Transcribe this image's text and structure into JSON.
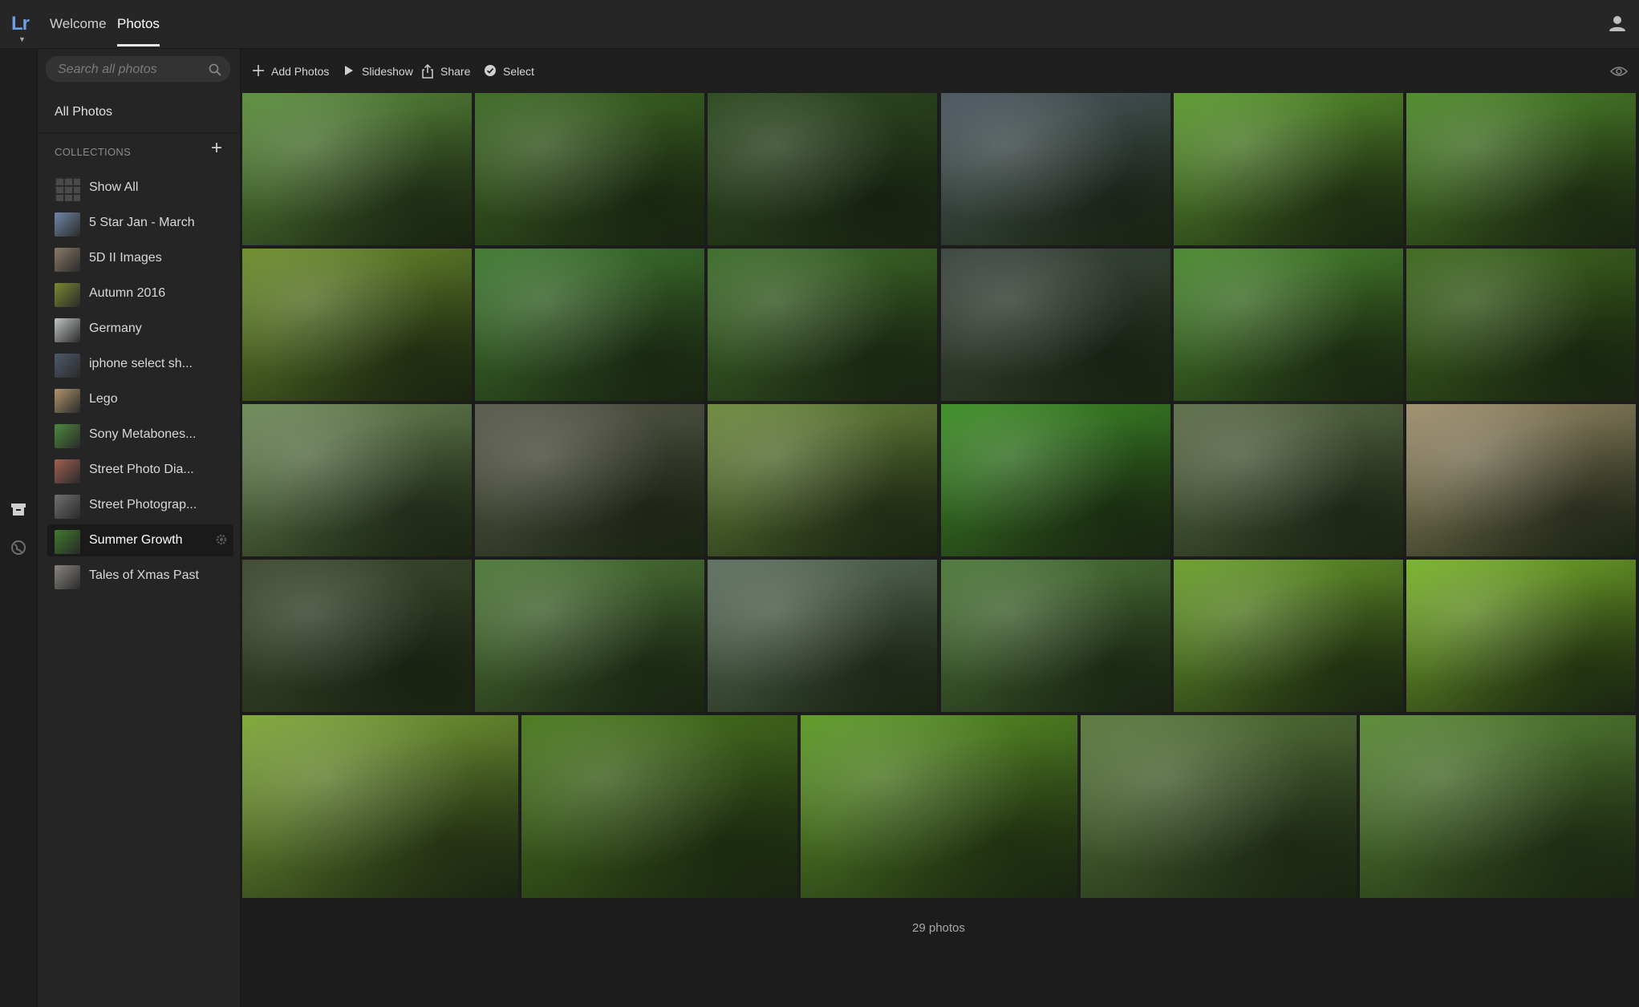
{
  "app": {
    "logo": "Lr"
  },
  "nav": {
    "tabs": [
      {
        "label": "Welcome"
      },
      {
        "label": "Photos"
      }
    ]
  },
  "sidebar": {
    "search_placeholder": "Search all photos",
    "all_photos": "All Photos",
    "collections_label": "COLLECTIONS",
    "collections": [
      {
        "name": "Show All",
        "thumb": "grid"
      },
      {
        "name": "5 Star Jan - March",
        "thumb": "#6f87a8"
      },
      {
        "name": "5D II Images",
        "thumb": "#8a7a66"
      },
      {
        "name": "Autumn 2016",
        "thumb": "#7a8a2f"
      },
      {
        "name": "Germany",
        "thumb": "#bfc3c4"
      },
      {
        "name": "iphone select sh...",
        "thumb": "#4e5a6b"
      },
      {
        "name": "Lego",
        "thumb": "#b2946c"
      },
      {
        "name": "Sony Metabones...",
        "thumb": "#4d8a3c"
      },
      {
        "name": "Street Photo Dia...",
        "thumb": "#a06050"
      },
      {
        "name": "Street Photograp...",
        "thumb": "#707070"
      },
      {
        "name": "Summer Growth",
        "thumb": "#3e7a2a",
        "selected": true
      },
      {
        "name": "Tales of Xmas Past",
        "thumb": "#8a8680"
      }
    ]
  },
  "toolbar": {
    "add_photos": "Add Photos",
    "slideshow": "Slideshow",
    "share": "Share",
    "select": "Select"
  },
  "grid": {
    "rows": [
      [
        "#5c8f3d",
        "#3d6a24",
        "#2c4a20",
        "#4a5660",
        "#5c9a2e",
        "#4f8a2a"
      ],
      [
        "#6d8e2c",
        "#3f7a30",
        "#3e6e2a",
        "#3c4640",
        "#4a8a2e",
        "#3e6a1e"
      ],
      [
        "#6f8a5a",
        "#5a5a4e",
        "#6e8a3e",
        "#3c8e26",
        "#5e6e4a",
        "#a08f6e"
      ],
      [
        "#3e4a30",
        "#4f7a3a",
        "#5e7060",
        "#4e7a3c",
        "#6aa02a",
        "#7ab42a"
      ],
      [
        "#7fa838",
        "#4a7a1e",
        "#5e9a26",
        "#5a7a3e",
        "#5a8a36"
      ]
    ]
  },
  "status": {
    "count": "29 photos"
  }
}
